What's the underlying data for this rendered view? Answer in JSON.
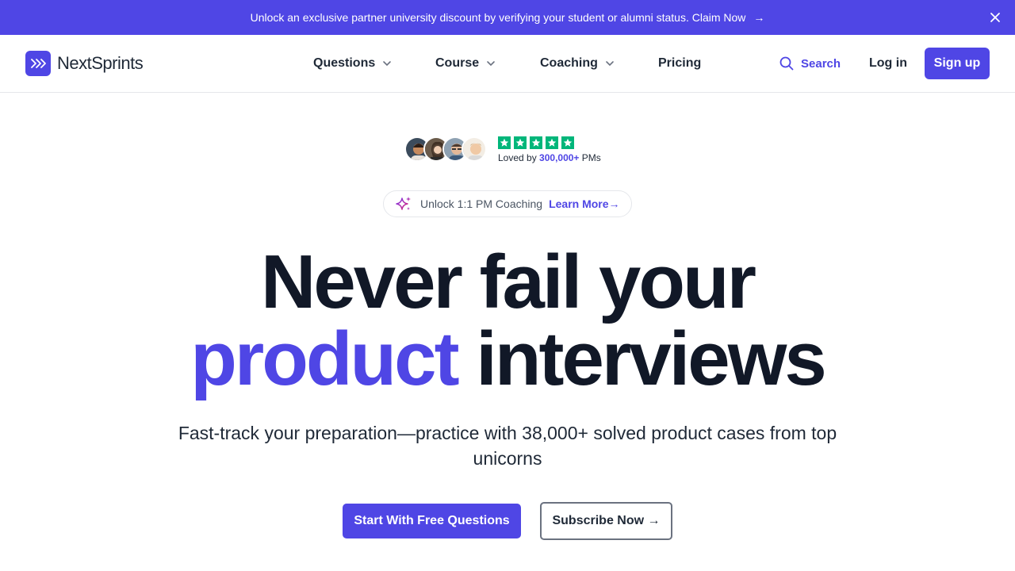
{
  "banner": {
    "text": "Unlock an exclusive partner university discount by verifying your student or alumni status. Claim Now",
    "arrow": "→"
  },
  "nav": {
    "brand": "NextSprints",
    "items": [
      {
        "label": "Questions",
        "has_dropdown": true
      },
      {
        "label": "Course",
        "has_dropdown": true
      },
      {
        "label": "Coaching",
        "has_dropdown": true
      },
      {
        "label": "Pricing",
        "has_dropdown": false
      }
    ],
    "search_label": "Search",
    "login_label": "Log in",
    "signup_label": "Sign up"
  },
  "proof": {
    "rating_stars": 5,
    "loved_prefix": "Loved by",
    "loved_count": "300,000+",
    "loved_suffix": "PMs"
  },
  "pill": {
    "text": "Unlock 1:1 PM Coaching",
    "link": "Learn More→"
  },
  "hero": {
    "line1": "Never fail your",
    "line2_accent": "product",
    "line2_rest": "interviews",
    "subtitle": "Fast-track your preparation—practice with 38,000+ solved product cases from top unicorns",
    "primary_cta": "Start With Free Questions",
    "secondary_cta": "Subscribe Now →"
  },
  "colors": {
    "brand": "#4f46e5",
    "trustpilot": "#00b67a",
    "text": "#111827"
  }
}
